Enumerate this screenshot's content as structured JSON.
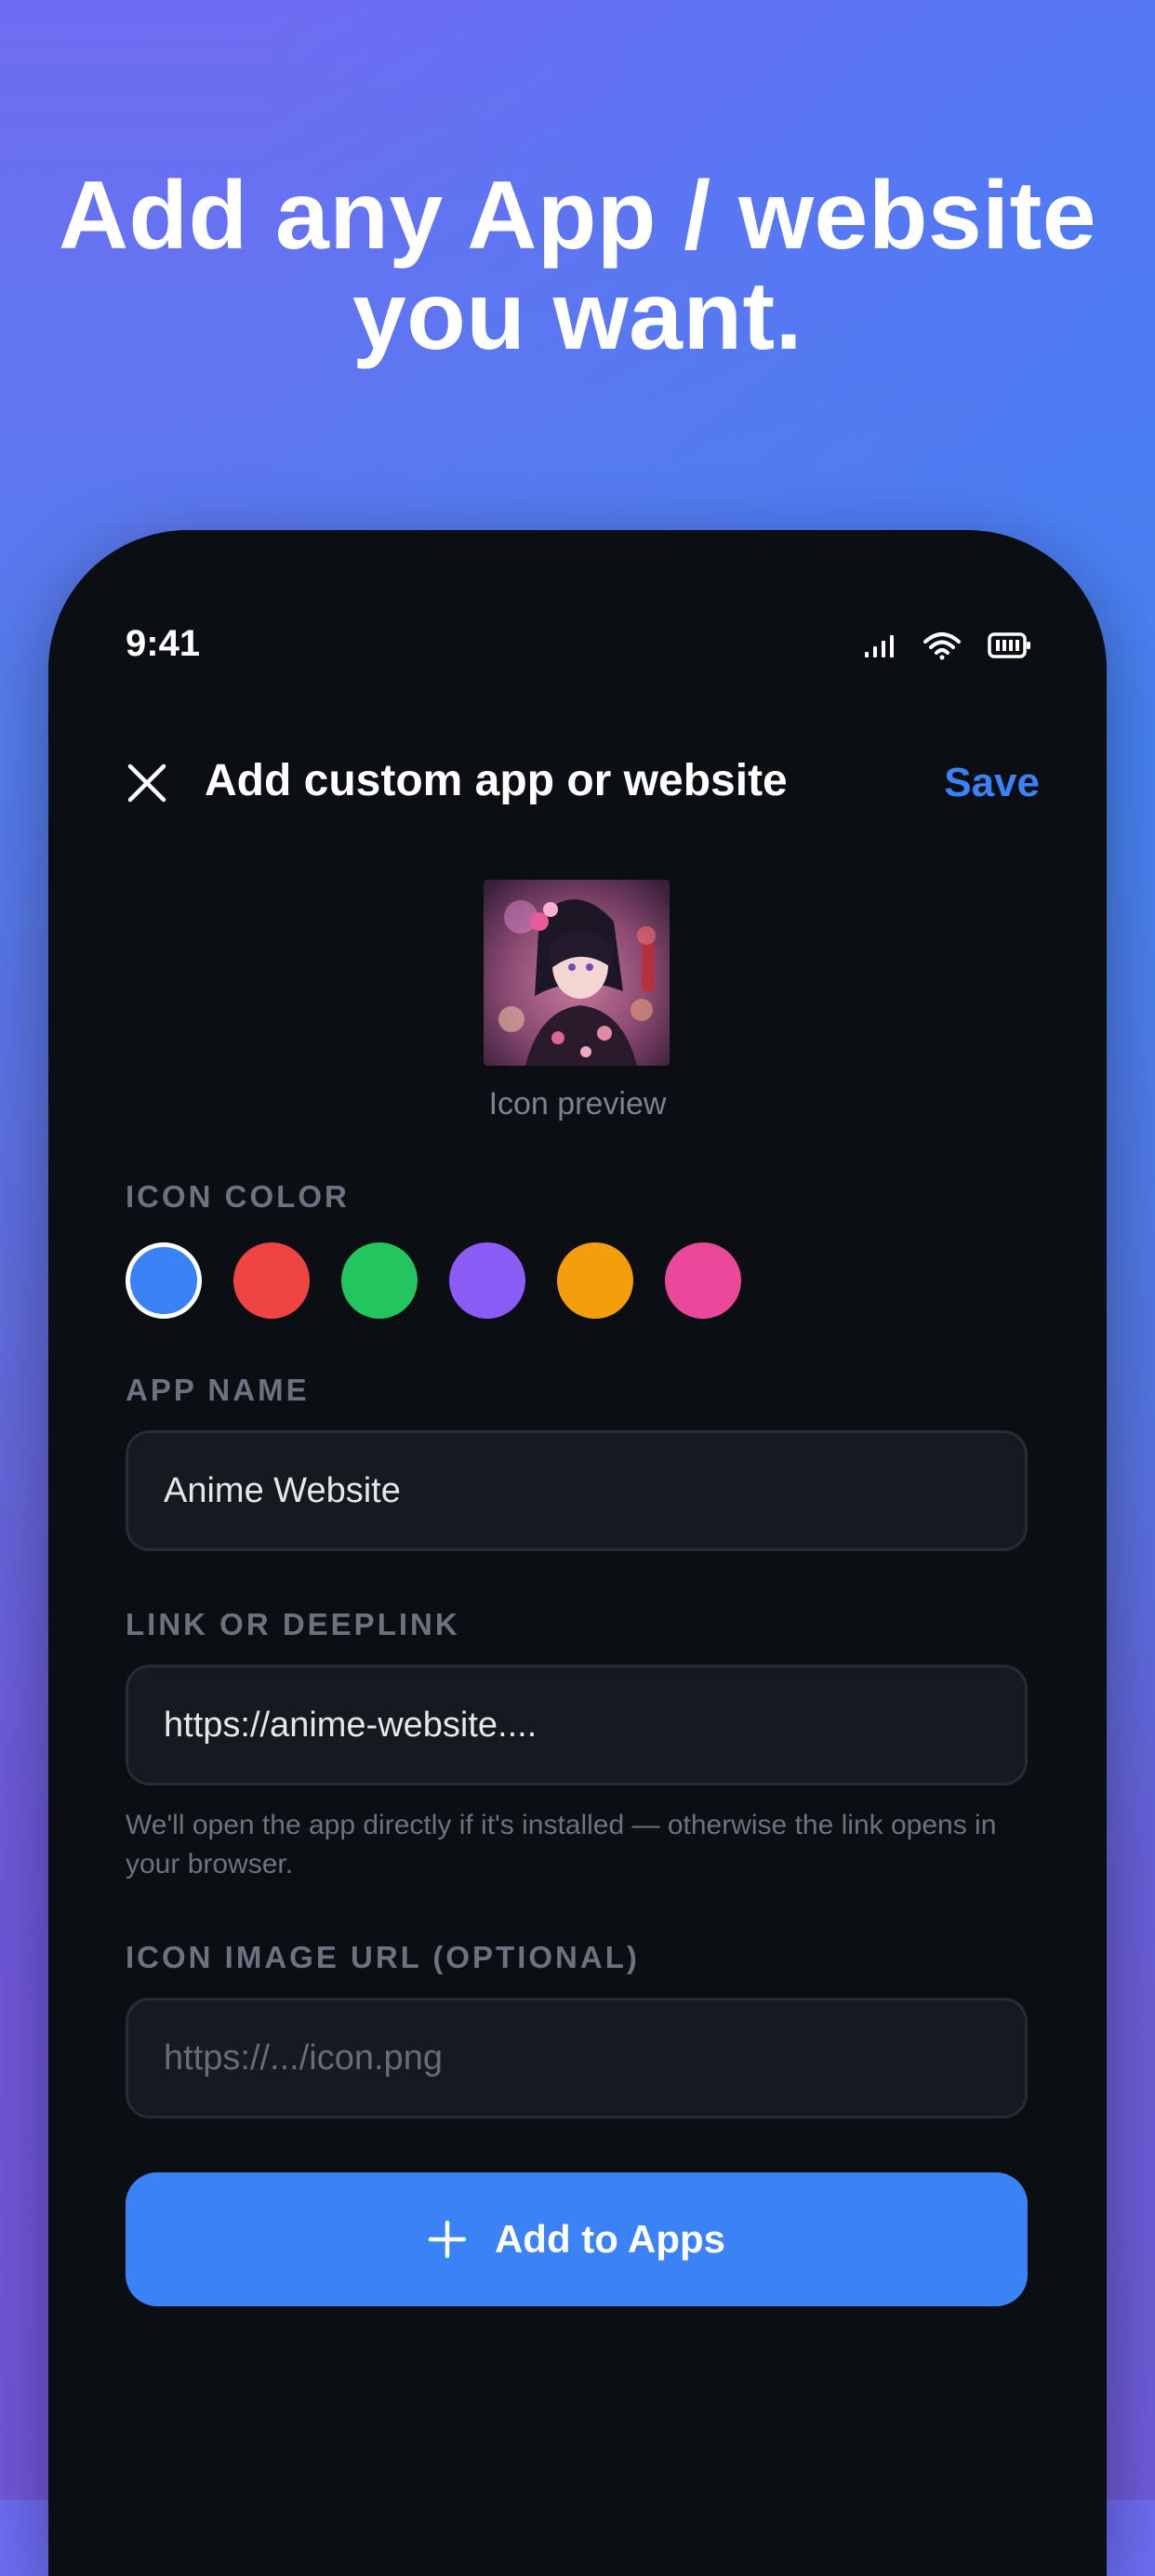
{
  "headline": {
    "line1": "Add any App / website",
    "line2": "you want."
  },
  "status_bar": {
    "time": "9:41",
    "icons": [
      "signal-icon",
      "wifi-icon",
      "battery-icon"
    ]
  },
  "header": {
    "close_icon": "close-icon",
    "title": "Add custom app or website",
    "save_label": "Save"
  },
  "icon_preview": {
    "label": "Icon preview"
  },
  "icon_color": {
    "label": "ICON COLOR",
    "options": [
      "#3b82f6",
      "#ef4444",
      "#22c55e",
      "#8b5cf6",
      "#f59e0b",
      "#ec4899"
    ],
    "selected_index": 0
  },
  "app_name": {
    "label": "APP NAME",
    "value": "Anime Website"
  },
  "link": {
    "label": "LINK OR DEEPLINK",
    "value": "https://anime-website....",
    "hint": "We'll open the app directly if it's installed — otherwise the link opens in your browser."
  },
  "icon_url": {
    "label": "ICON IMAGE URL (OPTIONAL)",
    "placeholder": "https://.../icon.png"
  },
  "add_button": {
    "icon": "plus-icon",
    "label": "Add to Apps"
  },
  "colors": {
    "accent": "#3b82f6",
    "screen_bg": "#0b0e13",
    "field_bg": "#151a21"
  }
}
